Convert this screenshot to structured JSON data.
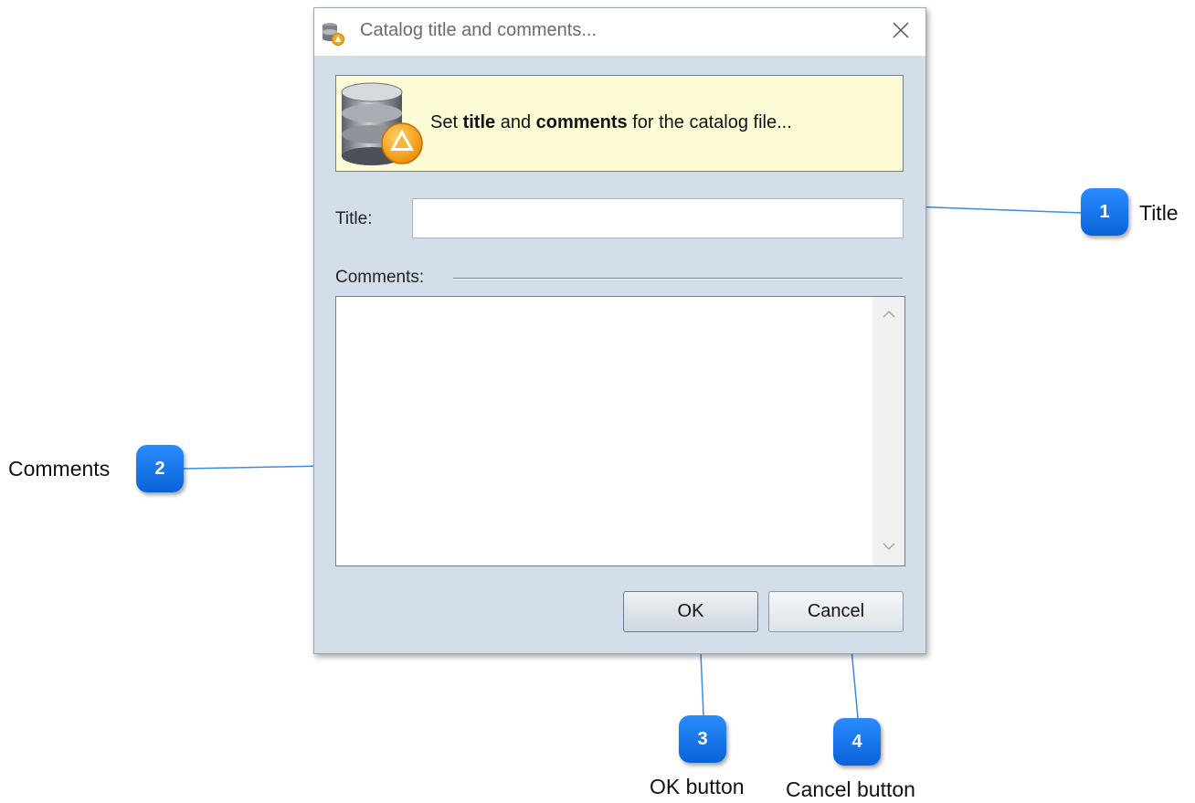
{
  "dialog": {
    "title": "Catalog title and comments...",
    "banner": {
      "prefix": "Set ",
      "bold1": "title",
      "middle": " and ",
      "bold2": "comments",
      "suffix": " for the catalog file..."
    },
    "title_field": {
      "label": "Title:",
      "value": ""
    },
    "comments_field": {
      "label": "Comments:",
      "value": ""
    },
    "buttons": {
      "ok": "OK",
      "cancel": "Cancel"
    },
    "icons": {
      "app": "database-warning-icon",
      "banner": "database-warning-icon",
      "close": "close-icon",
      "scroll_up": "chevron-up-icon",
      "scroll_down": "chevron-down-icon"
    }
  },
  "callouts": [
    {
      "number": "1",
      "label": "Title"
    },
    {
      "number": "2",
      "label": "Comments"
    },
    {
      "number": "3",
      "label": "OK button"
    },
    {
      "number": "4",
      "label": "Cancel button"
    }
  ],
  "colors": {
    "dialog_bg": "#d3deeb",
    "banner_bg": "#fdfbd6",
    "callout_badge": "#1577f0",
    "callout_line": "#3b8be0"
  }
}
